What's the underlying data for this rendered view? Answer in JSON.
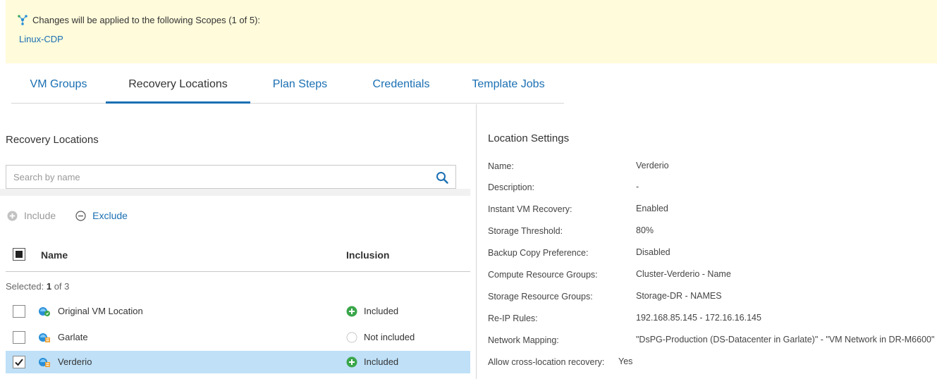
{
  "banner": {
    "message": "Changes will be applied to the following Scopes (1 of 5):",
    "scope_link": "Linux-CDP"
  },
  "tabs": [
    {
      "label": "VM Groups",
      "active": false
    },
    {
      "label": "Recovery Locations",
      "active": true
    },
    {
      "label": "Plan Steps",
      "active": false
    },
    {
      "label": "Credentials",
      "active": false
    },
    {
      "label": "Template Jobs",
      "active": false
    }
  ],
  "left": {
    "title": "Recovery Locations",
    "search": {
      "placeholder": "Search by name",
      "value": ""
    },
    "actions": {
      "include": "Include",
      "exclude": "Exclude"
    },
    "columns": {
      "name": "Name",
      "inclusion": "Inclusion"
    },
    "selected": {
      "prefix": "Selected:",
      "count": "1",
      "suffix": "of 3"
    },
    "rows": [
      {
        "name": "Original VM Location",
        "inclusion": "Included",
        "checked": false,
        "included": true
      },
      {
        "name": "Garlate",
        "inclusion": "Not included",
        "checked": false,
        "included": false
      },
      {
        "name": "Verderio",
        "inclusion": "Included",
        "checked": true,
        "included": true
      }
    ]
  },
  "settings": {
    "title": "Location Settings",
    "fields": [
      {
        "label": "Name:",
        "value": "Verderio"
      },
      {
        "label": "Description:",
        "value": "-"
      },
      {
        "label": "Instant VM Recovery:",
        "value": "Enabled"
      },
      {
        "label": "Storage Threshold:",
        "value": "80%"
      },
      {
        "label": "Backup Copy Preference:",
        "value": "Disabled"
      },
      {
        "label": "Compute Resource Groups:",
        "value": "Cluster-Verderio - Name"
      },
      {
        "label": "Storage Resource Groups:",
        "value": "Storage-DR - NAMES"
      },
      {
        "label": "Re-IP Rules:",
        "value": "192.168.85.145 - 172.16.16.145"
      },
      {
        "label": "Network Mapping:",
        "value": "\"DsPG-Production (DS-Datacenter in Garlate)\" - \"VM Network in DR-M6600\""
      },
      {
        "label": "Allow cross-location recovery:",
        "value": "Yes"
      }
    ]
  },
  "colors": {
    "accent": "#1a6fb3",
    "banner_bg": "#fffbdb",
    "selected_row": "#bfe0f7",
    "included_green": "#3aa64a"
  }
}
